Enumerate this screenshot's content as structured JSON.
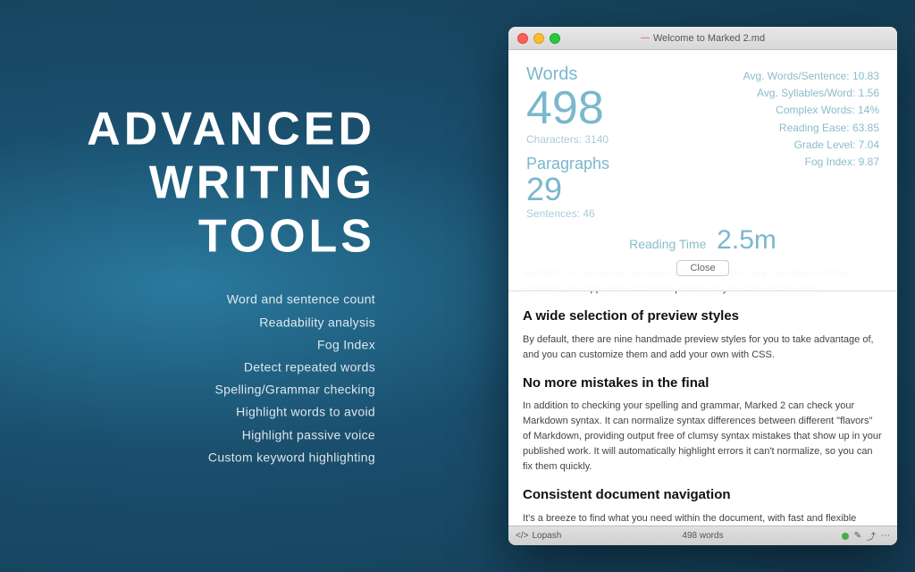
{
  "background": {
    "color": "#1e5a7a"
  },
  "left_panel": {
    "title_line1": "ADVANCED",
    "title_line2": "WRITING",
    "title_line3": "TOOLS",
    "features": [
      "Word and sentence count",
      "Readability analysis",
      "Fog Index",
      "Detect repeated words",
      "Spelling/Grammar checking",
      "Highlight words to avoid",
      "Highlight passive voice",
      "Custom keyword highlighting"
    ]
  },
  "window": {
    "title": "Welcome to Marked 2.md",
    "controls": {
      "close": "×",
      "minimize": "−",
      "maximize": "+"
    }
  },
  "stats": {
    "words_label": "Words",
    "words_count": "498",
    "characters": "Characters: 3140",
    "paragraphs_label": "Paragraphs",
    "paragraphs_count": "29",
    "sentences": "Sentences: 46",
    "avg_words_sentence": "Avg. Words/Sentence: 10.83",
    "avg_syllables_word": "Avg. Syllables/Word: 1.56",
    "complex_words": "Complex Words: 14%",
    "reading_ease": "Reading Ease: 63.85",
    "grade_level": "Grade Level: 7.04",
    "fog_index": "Fog Index: 9.87",
    "reading_time_label": "Reading Time",
    "reading_time_value": "2.5m",
    "close_button": "Close"
  },
  "document": {
    "intro": "and that's it. You can get previews while you write in any markdown editing software. The app even scrolls the preview to your most recent edits.",
    "sections": [
      {
        "heading": "A wide selection of preview styles",
        "body": "By default, there are nine handmade preview styles for you to take advantage of, and you can customize them and add your own with CSS."
      },
      {
        "heading": "No more mistakes in the final",
        "body": "In addition to checking your spelling and grammar, Marked 2 can check your Markdown syntax. It can normalize syntax differences between different \"flavors\" of Markdown, providing output free of clumsy syntax mistakes that show up in your published work. It will automatically highlight errors it can't normalize, so you can fix them quickly."
      },
      {
        "heading": "Consistent document navigation",
        "body": "It's a breeze to find what you need within the document, with fast and flexible search, automatic table of contents, bookmarking, visual document overview, collapsible sections, and more. You'll also love that it's fully keyboard navigable."
      }
    ]
  },
  "status_bar": {
    "left_icon": "</>",
    "name": "Lopash",
    "word_count": "498 words"
  }
}
